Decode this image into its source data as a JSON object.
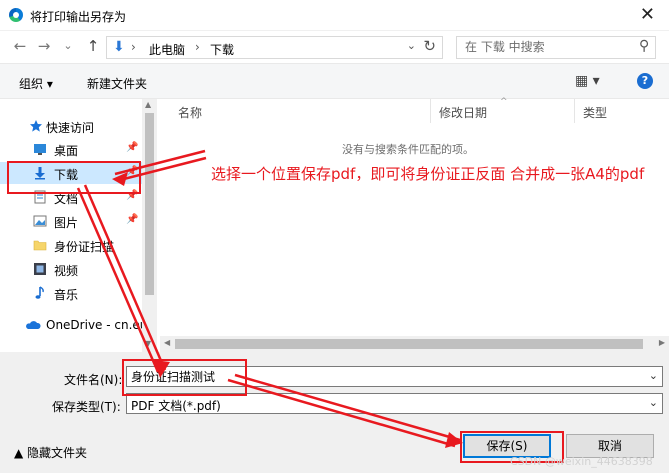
{
  "window": {
    "title": "将打印输出另存为",
    "close_glyph": "✕"
  },
  "nav": {
    "back": "←",
    "forward": "→",
    "recent": "⌄",
    "up": "↑"
  },
  "address": {
    "download_glyph": "⬇",
    "crumb1": "此电脑",
    "crumb2": "下载",
    "chevron": "›",
    "dropdown": "⌄",
    "refresh": "↻"
  },
  "search": {
    "placeholder": "在 下载 中搜索",
    "icon": "⚲"
  },
  "toolbar": {
    "organize": "组织 ▾",
    "new_folder": "新建文件夹",
    "view_icon": "▦ ▾",
    "help": "?"
  },
  "sidebar": {
    "quick_access": "快速访问",
    "items": [
      {
        "label": "桌面",
        "icon": "desktop-icon",
        "pinned": true
      },
      {
        "label": "下载",
        "icon": "download-icon",
        "pinned": true
      },
      {
        "label": "文档",
        "icon": "document-icon",
        "pinned": true
      },
      {
        "label": "图片",
        "icon": "picture-icon",
        "pinned": true
      },
      {
        "label": "身份证扫描",
        "icon": "folder-icon",
        "pinned": false
      },
      {
        "label": "视频",
        "icon": "video-icon",
        "pinned": false
      },
      {
        "label": "音乐",
        "icon": "music-icon",
        "pinned": false
      }
    ],
    "onedrive": "OneDrive - cn.eu",
    "pin_glyph": "📌"
  },
  "columns": {
    "name": "名称",
    "modified": "修改日期",
    "type": "类型"
  },
  "empty_message": "没有与搜索条件匹配的项。",
  "form": {
    "filename_label": "文件名(N):",
    "filename_value": "身份证扫描测试",
    "filetype_label": "保存类型(T):",
    "filetype_value": "PDF 文档(*.pdf)",
    "dropdown": "⌄"
  },
  "buttons": {
    "save": "保存(S)",
    "cancel": "取消",
    "hide_folders": "▲  隐藏文件夹"
  },
  "annotation": {
    "text": "选择一个位置保存pdf，即可将身份证正反面 合并成一张A4的pdf",
    "color": "#e8191f"
  },
  "watermark": "CSDN @weixin_44638398",
  "colors": {
    "selected": "#cce8ff",
    "accent": "#0078d7",
    "annotation": "#e8191f"
  }
}
